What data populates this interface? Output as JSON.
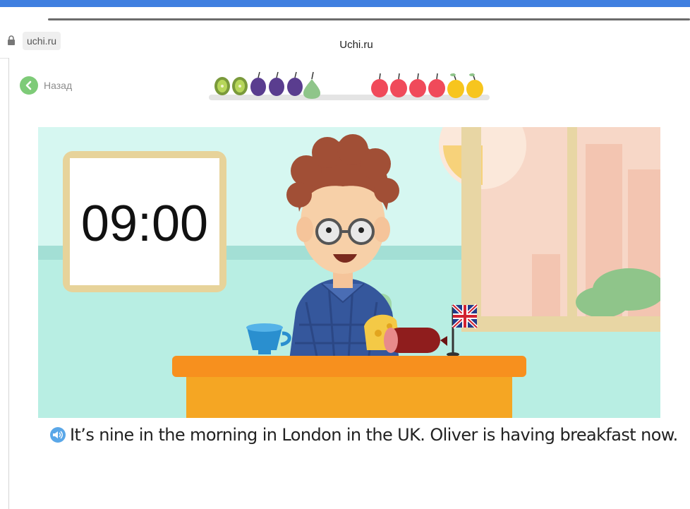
{
  "browser": {
    "domain": "uchi.ru",
    "title": "Uchi.ru"
  },
  "nav": {
    "back_label": "Назад"
  },
  "progress": {
    "left_group": [
      "kiwi",
      "kiwi",
      "plum",
      "plum",
      "plum",
      "pear"
    ],
    "right_group": [
      "apple",
      "apple",
      "apple",
      "apple",
      "lemon",
      "lemon"
    ]
  },
  "scene": {
    "clock_time": "09:00"
  },
  "caption": {
    "text": "It’s nine in the morning in London in the UK. Oliver is having breakfast now."
  },
  "colors": {
    "accent_green": "#7ecb78",
    "top_bar_blue": "#3f7fe0",
    "speaker_blue": "#5aa7e8",
    "table_orange": "#f7901e"
  }
}
